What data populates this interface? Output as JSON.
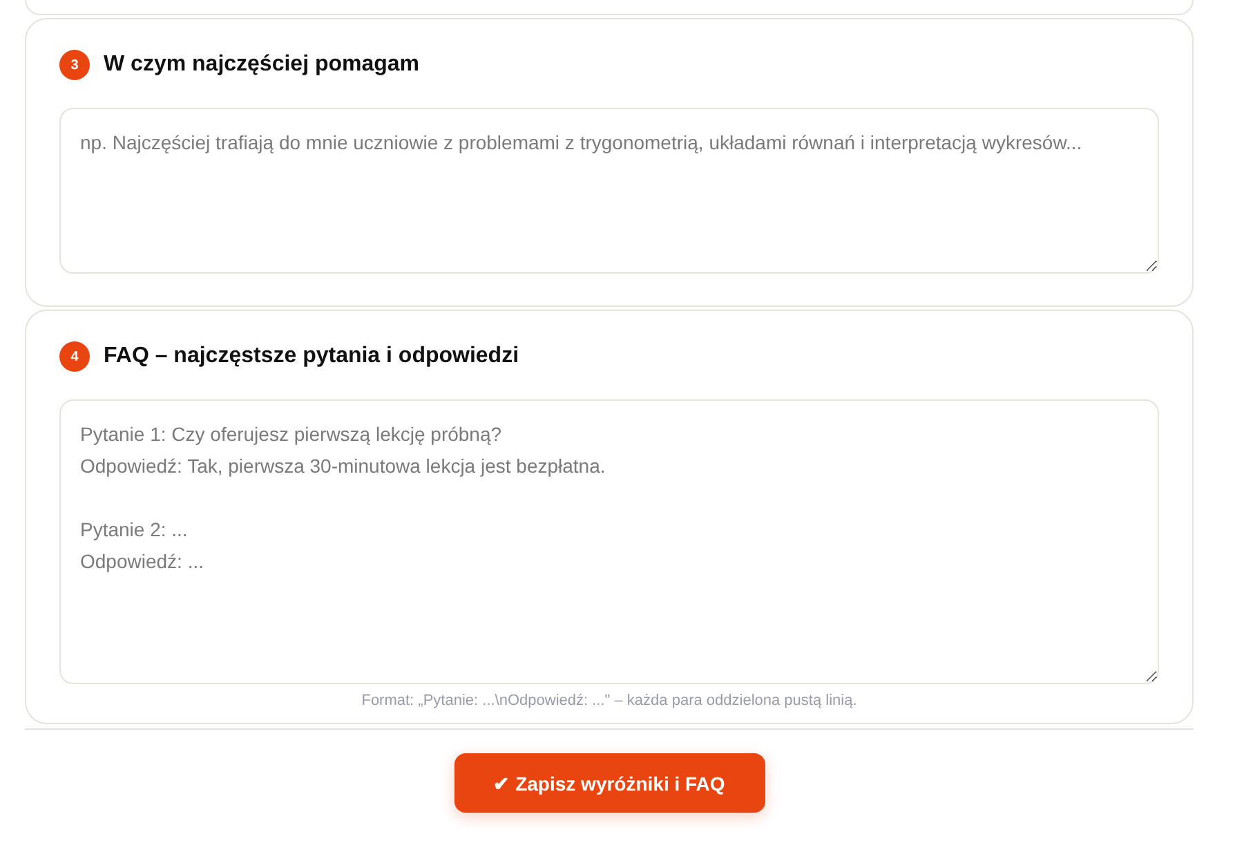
{
  "sections": [
    {
      "number": "3",
      "title": "W czym najczęściej pomagam",
      "field": {
        "placeholder": "np. Najczęściej trafiają do mnie uczniowie z problemami z trygonometrią, układami równań i interpretacją wykresów..."
      }
    },
    {
      "number": "4",
      "title": "FAQ – najczęstsze pytania i odpowiedzi",
      "field": {
        "placeholder": "Pytanie 1: Czy oferujesz pierwszą lekcję próbną?\nOdpowiedź: Tak, pierwsza 30-minutowa lekcja jest bezpłatna.\n\nPytanie 2: ...\nOdpowiedź: ..."
      },
      "hint": "Format: „Pytanie: ...\\nOdpowiedź: ...\" – każda para oddzielona pustą linią."
    }
  ],
  "save_button": {
    "label": "✔ Zapisz wyróżniki i FAQ"
  }
}
